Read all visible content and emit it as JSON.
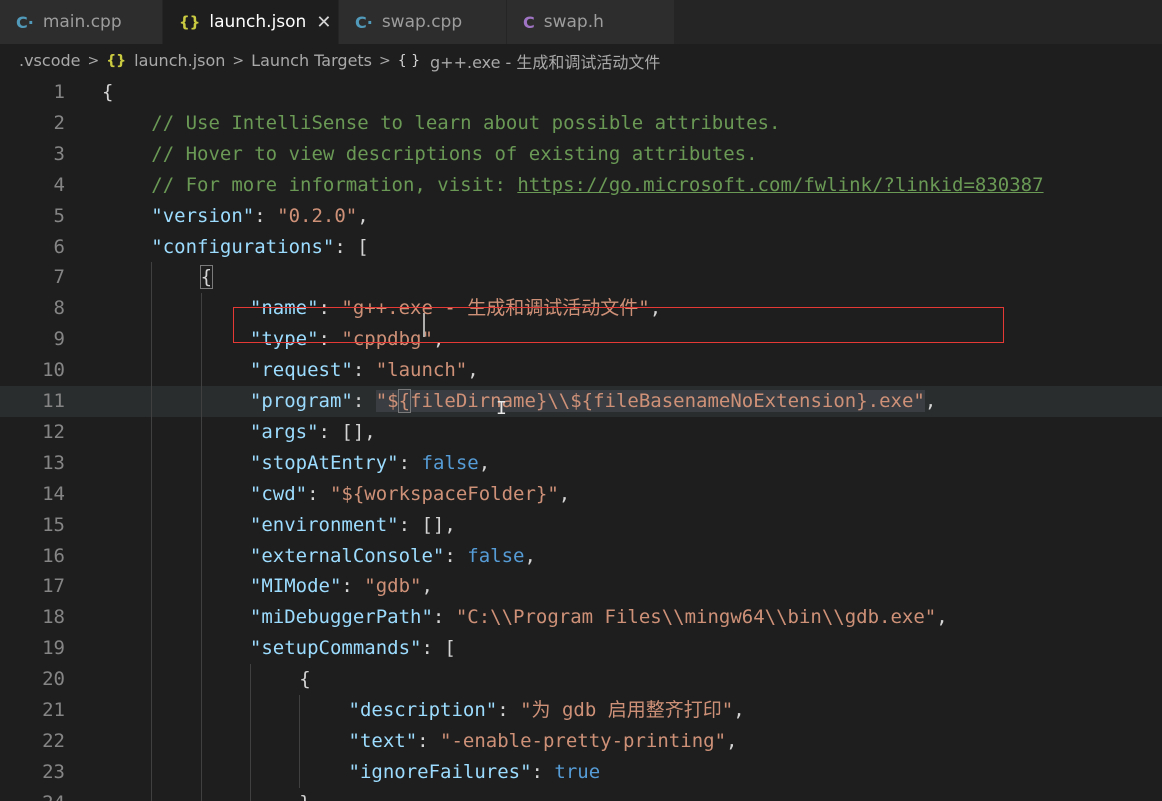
{
  "tabs": [
    {
      "label": "main.cpp",
      "icon": "cpp-file-icon",
      "active": false
    },
    {
      "label": "launch.json",
      "icon": "json-file-icon",
      "active": true
    },
    {
      "label": "swap.cpp",
      "icon": "cpp-file-icon",
      "active": false
    },
    {
      "label": "swap.h",
      "icon": "c-header-file-icon",
      "active": false
    }
  ],
  "breadcrumb": {
    "folder": ".vscode",
    "file": "launch.json",
    "section": "Launch Targets",
    "item": "g++.exe - 生成和调试活动文件"
  },
  "colors": {
    "background": "#1e1e1e",
    "key": "#9cdcfe",
    "string": "#ce9178",
    "comment": "#6a9955",
    "boolean": "#569cd6",
    "highlight_box": "#e53935"
  },
  "lines": [
    {
      "n": "1",
      "indent": 0,
      "tokens": [
        {
          "t": "{",
          "c": "p"
        }
      ]
    },
    {
      "n": "2",
      "indent": 1,
      "tokens": [
        {
          "t": "// Use IntelliSense to learn about possible attributes.",
          "c": "c"
        }
      ]
    },
    {
      "n": "3",
      "indent": 1,
      "tokens": [
        {
          "t": "// Hover to view descriptions of existing attributes.",
          "c": "c"
        }
      ]
    },
    {
      "n": "4",
      "indent": 1,
      "tokens": [
        {
          "t": "// For more information, visit: ",
          "c": "c"
        },
        {
          "t": "https://go.microsoft.com/fwlink/?linkid=830387",
          "c": "u"
        }
      ]
    },
    {
      "n": "5",
      "indent": 1,
      "tokens": [
        {
          "t": "\"version\"",
          "c": "k"
        },
        {
          "t": ": ",
          "c": "p"
        },
        {
          "t": "\"0.2.0\"",
          "c": "s"
        },
        {
          "t": ",",
          "c": "p"
        }
      ]
    },
    {
      "n": "6",
      "indent": 1,
      "tokens": [
        {
          "t": "\"configurations\"",
          "c": "k"
        },
        {
          "t": ": [",
          "c": "p"
        }
      ]
    },
    {
      "n": "7",
      "indent": 2,
      "tokens": [
        {
          "t": "{",
          "c": "p brk"
        }
      ]
    },
    {
      "n": "8",
      "indent": 3,
      "tokens": [
        {
          "t": "\"name\"",
          "c": "k"
        },
        {
          "t": ": ",
          "c": "p"
        },
        {
          "t": "\"g++.exe - 生成和调试活动文件\"",
          "c": "s"
        },
        {
          "t": ",",
          "c": "p"
        }
      ]
    },
    {
      "n": "9",
      "indent": 3,
      "tokens": [
        {
          "t": "\"type\"",
          "c": "k"
        },
        {
          "t": ": ",
          "c": "p"
        },
        {
          "t": "\"cppdbg\"",
          "c": "s"
        },
        {
          "t": ",",
          "c": "p"
        }
      ]
    },
    {
      "n": "10",
      "indent": 3,
      "tokens": [
        {
          "t": "\"request\"",
          "c": "k"
        },
        {
          "t": ": ",
          "c": "p"
        },
        {
          "t": "\"launch\"",
          "c": "s"
        },
        {
          "t": ",",
          "c": "p"
        }
      ]
    },
    {
      "n": "11",
      "indent": 3,
      "current": true,
      "tokens": [
        {
          "t": "\"program\"",
          "c": "k"
        },
        {
          "t": ": ",
          "c": "p"
        },
        {
          "t": "\"$",
          "c": "s sel"
        },
        {
          "t": "{",
          "c": "s sel brk"
        },
        {
          "t": "fileDirname}\\\\${fileBasenameNoExtension}.exe\"",
          "c": "s sel"
        },
        {
          "t": ",",
          "c": "p"
        }
      ]
    },
    {
      "n": "12",
      "indent": 3,
      "tokens": [
        {
          "t": "\"args\"",
          "c": "k"
        },
        {
          "t": ": [],",
          "c": "p"
        }
      ]
    },
    {
      "n": "13",
      "indent": 3,
      "tokens": [
        {
          "t": "\"stopAtEntry\"",
          "c": "k"
        },
        {
          "t": ": ",
          "c": "p"
        },
        {
          "t": "false",
          "c": "b"
        },
        {
          "t": ",",
          "c": "p"
        }
      ]
    },
    {
      "n": "14",
      "indent": 3,
      "tokens": [
        {
          "t": "\"cwd\"",
          "c": "k"
        },
        {
          "t": ": ",
          "c": "p"
        },
        {
          "t": "\"${workspaceFolder}\"",
          "c": "s"
        },
        {
          "t": ",",
          "c": "p"
        }
      ]
    },
    {
      "n": "15",
      "indent": 3,
      "tokens": [
        {
          "t": "\"environment\"",
          "c": "k"
        },
        {
          "t": ": [],",
          "c": "p"
        }
      ]
    },
    {
      "n": "16",
      "indent": 3,
      "tokens": [
        {
          "t": "\"externalConsole\"",
          "c": "k"
        },
        {
          "t": ": ",
          "c": "p"
        },
        {
          "t": "false",
          "c": "b"
        },
        {
          "t": ",",
          "c": "p"
        }
      ]
    },
    {
      "n": "17",
      "indent": 3,
      "tokens": [
        {
          "t": "\"MIMode\"",
          "c": "k"
        },
        {
          "t": ": ",
          "c": "p"
        },
        {
          "t": "\"gdb\"",
          "c": "s"
        },
        {
          "t": ",",
          "c": "p"
        }
      ]
    },
    {
      "n": "18",
      "indent": 3,
      "tokens": [
        {
          "t": "\"miDebuggerPath\"",
          "c": "k"
        },
        {
          "t": ": ",
          "c": "p"
        },
        {
          "t": "\"C:\\\\Program Files\\\\mingw64\\\\bin\\\\gdb.exe\"",
          "c": "s"
        },
        {
          "t": ",",
          "c": "p"
        }
      ]
    },
    {
      "n": "19",
      "indent": 3,
      "tokens": [
        {
          "t": "\"setupCommands\"",
          "c": "k"
        },
        {
          "t": ": [",
          "c": "p"
        }
      ]
    },
    {
      "n": "20",
      "indent": 4,
      "tokens": [
        {
          "t": "{",
          "c": "p"
        }
      ]
    },
    {
      "n": "21",
      "indent": 5,
      "tokens": [
        {
          "t": "\"description\"",
          "c": "k"
        },
        {
          "t": ": ",
          "c": "p"
        },
        {
          "t": "\"为 gdb 启用整齐打印\"",
          "c": "s"
        },
        {
          "t": ",",
          "c": "p"
        }
      ]
    },
    {
      "n": "22",
      "indent": 5,
      "tokens": [
        {
          "t": "\"text\"",
          "c": "k"
        },
        {
          "t": ": ",
          "c": "p"
        },
        {
          "t": "\"-enable-pretty-printing\"",
          "c": "s"
        },
        {
          "t": ",",
          "c": "p"
        }
      ]
    },
    {
      "n": "23",
      "indent": 5,
      "tokens": [
        {
          "t": "\"ignoreFailures\"",
          "c": "k"
        },
        {
          "t": ": ",
          "c": "p"
        },
        {
          "t": "true",
          "c": "b"
        }
      ]
    },
    {
      "n": "24",
      "indent": 4,
      "tokens": [
        {
          "t": "}",
          "c": "p"
        }
      ]
    }
  ]
}
